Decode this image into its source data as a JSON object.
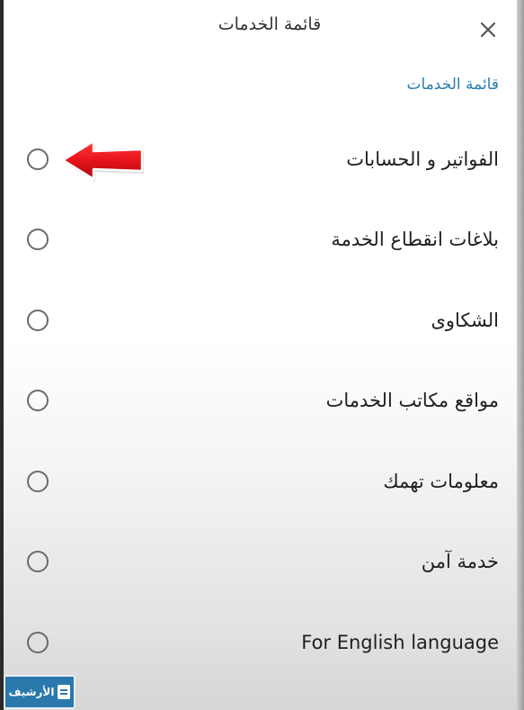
{
  "header": {
    "title": "قائمة الخدمات",
    "close_icon": "close-icon"
  },
  "section": {
    "label": "قائمة الخدمات"
  },
  "options": [
    {
      "label": "الفواتير و الحسابات",
      "selected": false
    },
    {
      "label": "بلاغات انقطاع الخدمة",
      "selected": false
    },
    {
      "label": "الشكاوى",
      "selected": false
    },
    {
      "label": "مواقع مكاتب الخدمات",
      "selected": false
    },
    {
      "label": "معلومات تهمك",
      "selected": false
    },
    {
      "label": "خدمة آمن",
      "selected": false
    },
    {
      "label": "For English language",
      "selected": false
    }
  ],
  "annotation": {
    "icon": "red-arrow-icon",
    "color": "#e8141b"
  },
  "watermark": {
    "text": "الأرشيف",
    "color": "#2b78ad"
  }
}
